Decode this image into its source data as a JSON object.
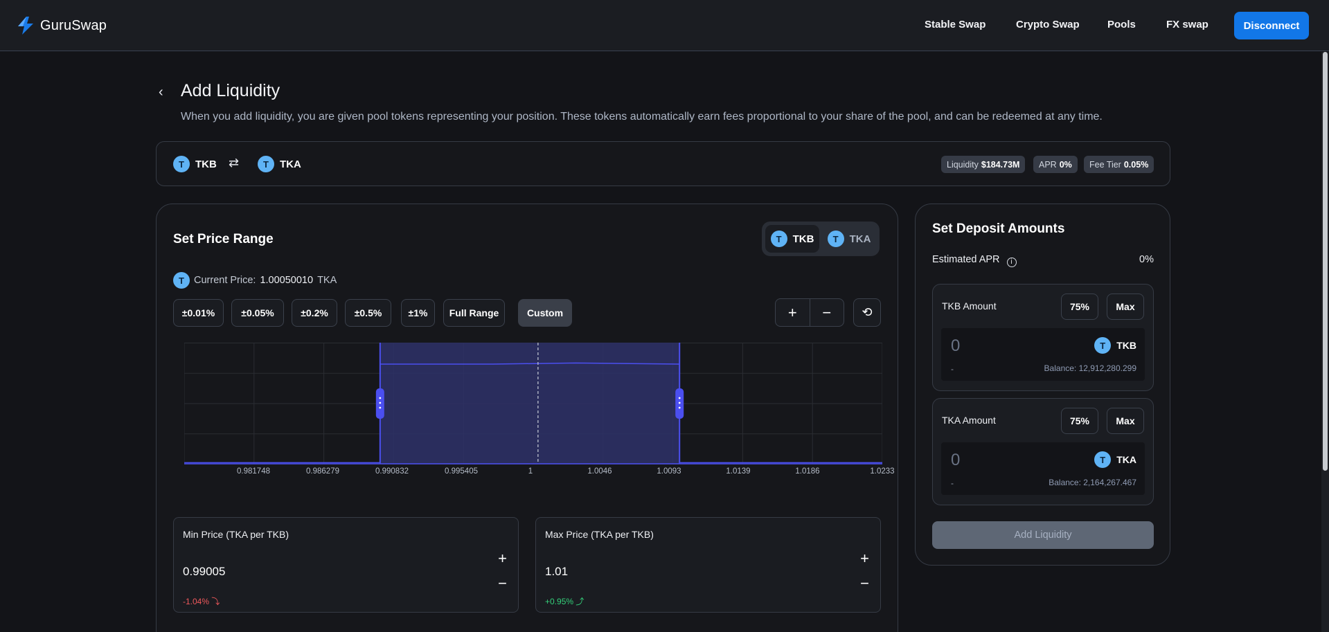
{
  "app": {
    "name": "GuruSwap"
  },
  "nav": {
    "links": [
      "Stable Swap",
      "Crypto Swap",
      "Pools",
      "FX swap"
    ],
    "disconnect": "Disconnect"
  },
  "header": {
    "title": "Add Liquidity",
    "description": "When you add liquidity, you are given pool tokens representing your position. These tokens automatically earn fees proportional to your share of the pool, and can be redeemed at any time."
  },
  "pair": {
    "token_a": "TKB",
    "token_b": "TKA",
    "icon_letter": "T",
    "liquidity_label": "Liquidity",
    "liquidity_value": "$184.73M",
    "apr_label": "APR",
    "apr_value": "0%",
    "fee_label": "Fee Tier",
    "fee_value": "0.05%"
  },
  "price_range": {
    "title": "Set Price Range",
    "toggle": [
      "TKB",
      "TKA"
    ],
    "current_price_label": "Current Price:",
    "current_price_value": "1.00050010",
    "current_price_unit": "TKA",
    "presets": [
      "±0.01%",
      "±0.05%",
      "±0.2%",
      "±0.5%",
      "±1%",
      "Full Range",
      "Custom"
    ],
    "selected_preset": "Custom",
    "zoom_in": "+",
    "zoom_out": "−",
    "min_box": {
      "label": "Min Price (TKA per TKB)",
      "value": "0.99005",
      "pct": "-1.04%"
    },
    "max_box": {
      "label": "Max Price (TKA per TKB)",
      "value": "1.01",
      "pct": "+0.95%"
    }
  },
  "chart_data": {
    "type": "area",
    "x_ticks": [
      "0.981748",
      "0.986279",
      "0.990832",
      "0.995405",
      "1",
      "1.0046",
      "1.0093",
      "1.0139",
      "1.0186",
      "1.0233"
    ],
    "xlim": [
      0.97722,
      1.0233
    ],
    "current_price": 1.0005,
    "selected_range": [
      0.99005,
      1.01
    ],
    "liquidity_series": {
      "x": [
        0.97722,
        0.99005,
        0.99005,
        0.9975,
        1.003,
        1.01,
        1.01,
        1.0233
      ],
      "y": [
        0.01,
        0.01,
        0.9,
        0.9,
        0.91,
        0.9,
        0.01,
        0.01
      ]
    },
    "grid": true,
    "colors": {
      "range_fill": "#2e3168",
      "range_line": "#4b4ff0",
      "current_line": "#c9cdd6"
    }
  },
  "deposit": {
    "title": "Set Deposit Amounts",
    "apr_label": "Estimated APR",
    "apr_value": "0%",
    "cards": [
      {
        "label": "TKB Amount",
        "btn_75": "75%",
        "btn_max": "Max",
        "value": "0",
        "token": "TKB",
        "dash": "-",
        "balance": "Balance: 12,912,280.299"
      },
      {
        "label": "TKA Amount",
        "btn_75": "75%",
        "btn_max": "Max",
        "value": "0",
        "token": "TKA",
        "dash": "-",
        "balance": "Balance: 2,164,267.467"
      }
    ],
    "submit": "Add Liquidity"
  }
}
